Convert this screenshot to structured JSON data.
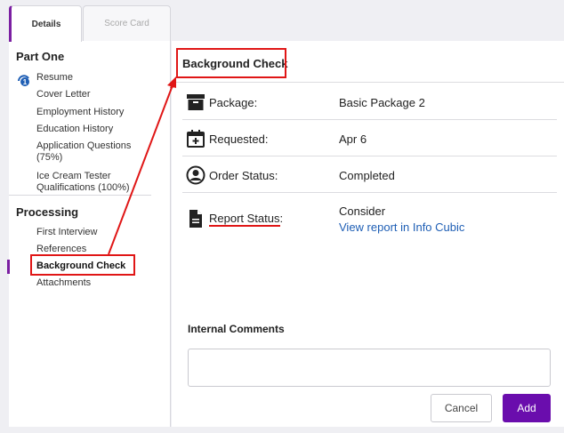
{
  "tabs": [
    {
      "label": "Details",
      "active": true
    },
    {
      "label": "Score Card",
      "active": false
    }
  ],
  "sidebar": {
    "part_one_title": "Part One",
    "part_one_items": [
      {
        "label": "Resume"
      },
      {
        "label": "Cover Letter"
      },
      {
        "label": "Employment History"
      },
      {
        "label": "Education History"
      },
      {
        "label": "Application Questions (75%)"
      },
      {
        "label": "Ice Cream Tester Qualifications (100%)"
      }
    ],
    "processing_title": "Processing",
    "processing_items": [
      {
        "label": "First Interview"
      },
      {
        "label": "References"
      },
      {
        "label": "Background Check"
      },
      {
        "label": "Attachments"
      }
    ]
  },
  "main": {
    "title": "Background Check",
    "rows": [
      {
        "label": "Package:",
        "value": "Basic Package 2",
        "icon": "archive-box-icon"
      },
      {
        "label": "Requested:",
        "value": "Apr 6",
        "icon": "calendar-plus-icon"
      },
      {
        "label": "Order Status:",
        "value": "Completed",
        "icon": "user-circle-icon"
      },
      {
        "label": "Report Status:",
        "value": "Consider",
        "link": "View report in Info Cubic",
        "icon": "document-icon"
      }
    ],
    "comments_label": "Internal Comments",
    "comments_value": "",
    "cancel_label": "Cancel",
    "add_label": "Add"
  },
  "colors": {
    "accent": "#6a0dad",
    "annotation_red": "#e01616",
    "link": "#1f5fb5"
  }
}
